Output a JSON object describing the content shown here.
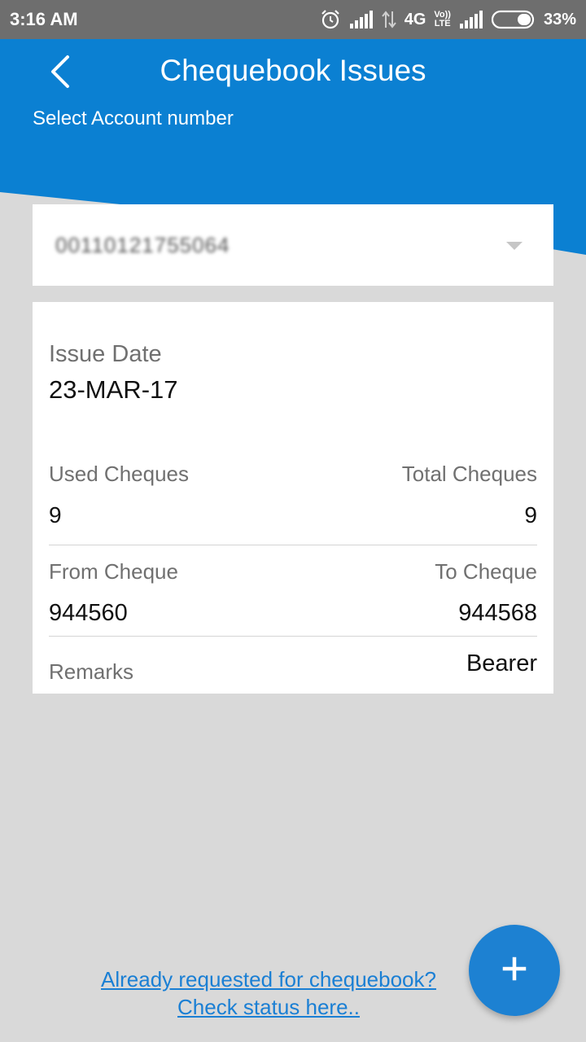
{
  "status_bar": {
    "time": "3:16 AM",
    "network": "4G",
    "volte_top": "Vo))",
    "volte_bottom": "LTE",
    "battery": "33%",
    "icons": [
      "alarm-icon",
      "signal-icon",
      "data-arrows-icon",
      "volte-icon",
      "signal-icon",
      "battery-icon"
    ]
  },
  "header": {
    "title": "Chequebook Issues",
    "select_label": "Select Account number",
    "color": "#0b80d2"
  },
  "account": {
    "number": "00110121755064"
  },
  "details": {
    "issue_date_label": "Issue Date",
    "issue_date": "23-MAR-17",
    "used_label": "Used Cheques",
    "used_value": "9",
    "total_label": "Total Cheques",
    "total_value": "9",
    "from_label": "From Cheque",
    "from_value": "944560",
    "to_label": "To Cheque",
    "to_value": "944568",
    "remarks_label": "Remarks",
    "remarks_value": "Bearer"
  },
  "footer": {
    "link_line1": "Already requested for chequebook?",
    "link_line2": "Check status here..",
    "fab_icon": "plus-icon",
    "fab_color": "#1d81d2"
  }
}
